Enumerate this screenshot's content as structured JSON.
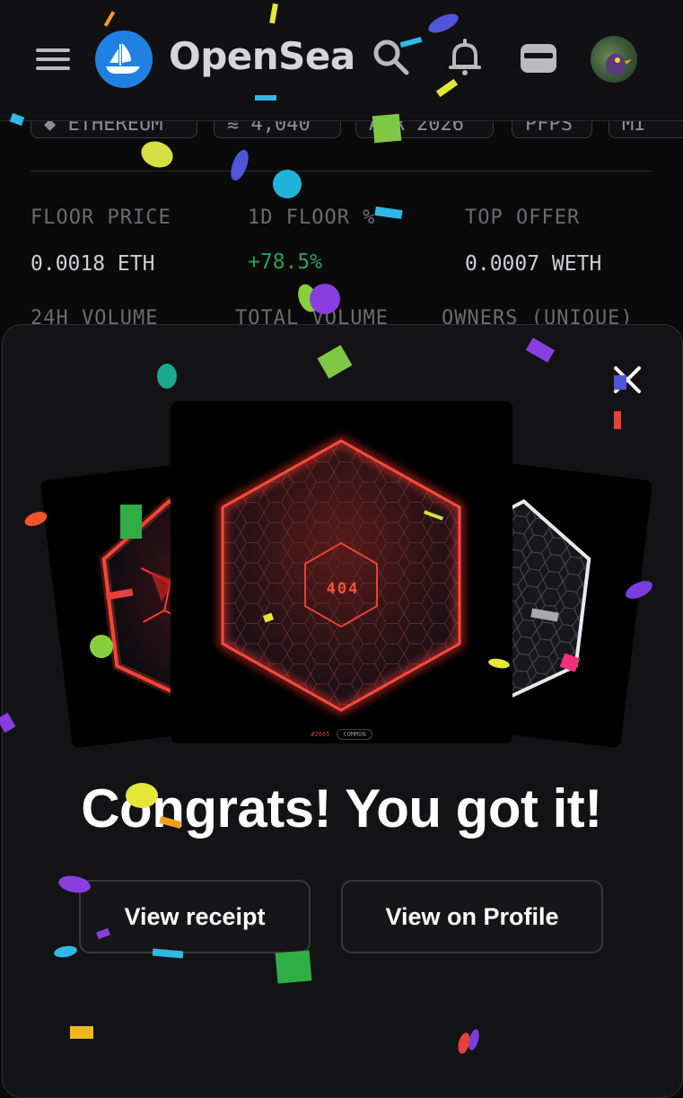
{
  "header": {
    "brand": "OpenSea",
    "icons": [
      "menu-icon",
      "opensea-logo",
      "search-icon",
      "bell-icon",
      "wallet-icon",
      "avatar"
    ]
  },
  "collection": {
    "pills": [
      "◆ ETHEREUM",
      "≋ 4,040",
      "APR 2026",
      "PFPS",
      "MI"
    ],
    "stats": [
      {
        "label": "FLOOR PRICE",
        "value": "0.0018 ETH"
      },
      {
        "label": "1D FLOOR %",
        "value": "+78.5%"
      },
      {
        "label": "TOP OFFER",
        "value": "0.0007 WETH"
      }
    ],
    "stats_row2_labels": [
      "24H VOLUME",
      "TOTAL VOLUME",
      "OWNERS (UNIQUE)"
    ]
  },
  "modal": {
    "card_text": "404",
    "card_id": "#2665",
    "card_rarity": "COMMON",
    "title": "Congrats! You got it!",
    "view_receipt": "View receipt",
    "view_profile": "View on Profile"
  },
  "colors": {
    "accent_blue": "#2081e2",
    "positive_green": "#2f9e55",
    "glow_red": "#ff3b30",
    "background": "#0a0a0b",
    "modal": "#131315"
  }
}
